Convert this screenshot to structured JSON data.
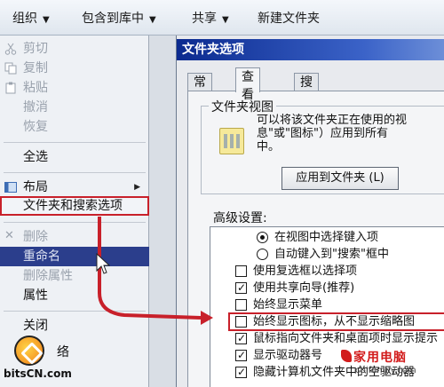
{
  "toolbar": {
    "organize": "组织",
    "include_in_library": "包含到库中",
    "share": "共享",
    "new_folder": "新建文件夹"
  },
  "menu": {
    "cut": "剪切",
    "copy": "复制",
    "paste": "粘贴",
    "undo": "撤消",
    "redo": "恢复",
    "select_all": "全选",
    "layout": "布局",
    "folder_search_options": "文件夹和搜索选项",
    "delete": "删除",
    "rename": "重命名",
    "remove_properties": "删除属性",
    "properties": "属性",
    "close": "关闭",
    "network_partial": "络"
  },
  "dialog": {
    "title": "文件夹选项",
    "tabs": [
      "常规",
      "查看",
      "搜索"
    ],
    "folder_view_legend": "文件夹视图",
    "folder_view_desc": [
      "可以将该文件夹正在使用的视",
      "息\"或\"图标\"）应用到所有",
      "中。"
    ],
    "apply_button": "应用到文件夹 (L)",
    "advanced_label": "高级设置:",
    "settings": [
      {
        "type": "radio",
        "checked": true,
        "indent": 2,
        "label": "在视图中选择键入项"
      },
      {
        "type": "radio",
        "checked": false,
        "indent": 2,
        "label": "自动键入到\"搜索\"框中"
      },
      {
        "type": "checkbox",
        "checked": false,
        "indent": 1,
        "label": "使用复选框以选择项"
      },
      {
        "type": "checkbox",
        "checked": true,
        "indent": 1,
        "label": "使用共享向导(推荐)"
      },
      {
        "type": "checkbox",
        "checked": false,
        "indent": 1,
        "label": "始终显示菜单"
      },
      {
        "type": "checkbox",
        "checked": false,
        "indent": 1,
        "label": "始终显示图标，从不显示缩略图"
      },
      {
        "type": "checkbox",
        "checked": true,
        "indent": 1,
        "label": "鼠标指向文件夹和桌面项时显示提示"
      },
      {
        "type": "checkbox",
        "checked": true,
        "indent": 1,
        "label": "显示驱动器号"
      },
      {
        "type": "checkbox",
        "checked": true,
        "indent": 1,
        "label": "隐藏计算机文件夹中的空驱动器"
      }
    ]
  },
  "logos": {
    "left": "bitsCN.com",
    "right_main": "家用电脑",
    "right_sub": "cbifamily.com"
  },
  "colors": {
    "highlight": "#c8202a",
    "selection": "#2b3e8c",
    "title_bar": "#0b2a8f"
  }
}
